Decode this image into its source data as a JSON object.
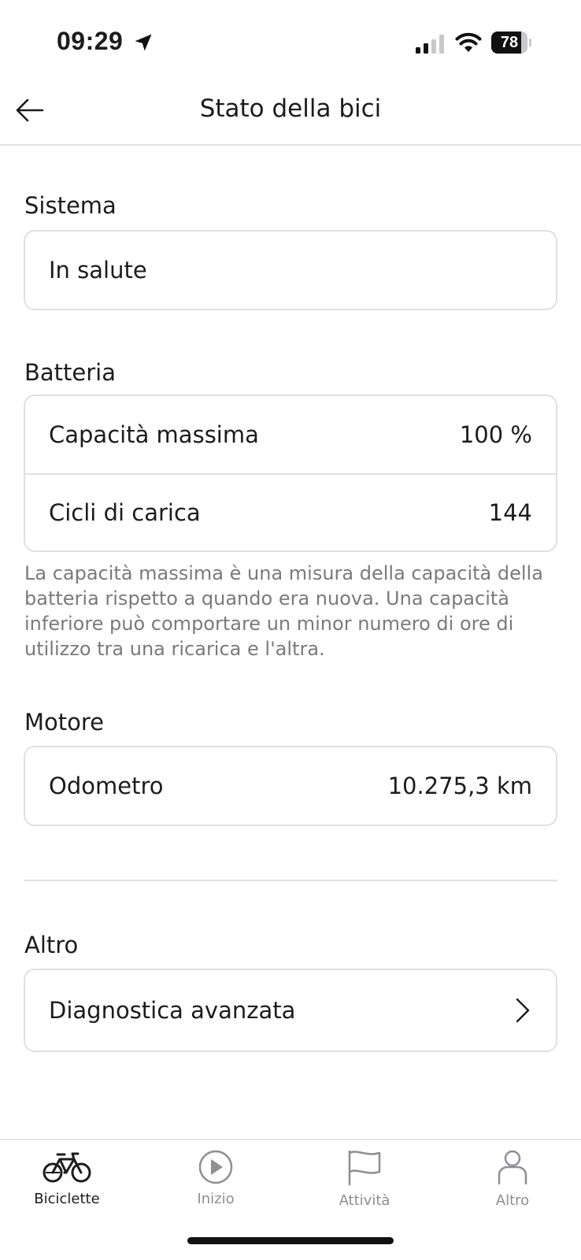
{
  "status": {
    "time": "09:29",
    "battery": "78"
  },
  "header": {
    "title": "Stato della bici",
    "back_icon": "arrow-left-icon"
  },
  "sections": {
    "system": {
      "title": "Sistema",
      "status_value": "In salute"
    },
    "battery": {
      "title": "Batteria",
      "rows": [
        {
          "label": "Capacità massima",
          "value": "100 %"
        },
        {
          "label": "Cicli di carica",
          "value": "144"
        }
      ],
      "footnote": "La capacità massima è una misura della capacità della batteria rispetto a quando era nuova. Una capacità inferiore può comportare un minor numero di ore di utilizzo tra una ricarica e l'altra."
    },
    "motor": {
      "title": "Motore",
      "rows": [
        {
          "label": "Odometro",
          "value": "10.275,3 km"
        }
      ]
    },
    "other": {
      "title": "Altro",
      "item_label": "Diagnostica avanzata"
    }
  },
  "tabs": [
    {
      "label": "Biciclette",
      "icon": "bike-icon",
      "active": true
    },
    {
      "label": "Inizio",
      "icon": "play-circle-icon",
      "active": false
    },
    {
      "label": "Attività",
      "icon": "flag-icon",
      "active": false
    },
    {
      "label": "Altro",
      "icon": "person-icon",
      "active": false
    }
  ]
}
